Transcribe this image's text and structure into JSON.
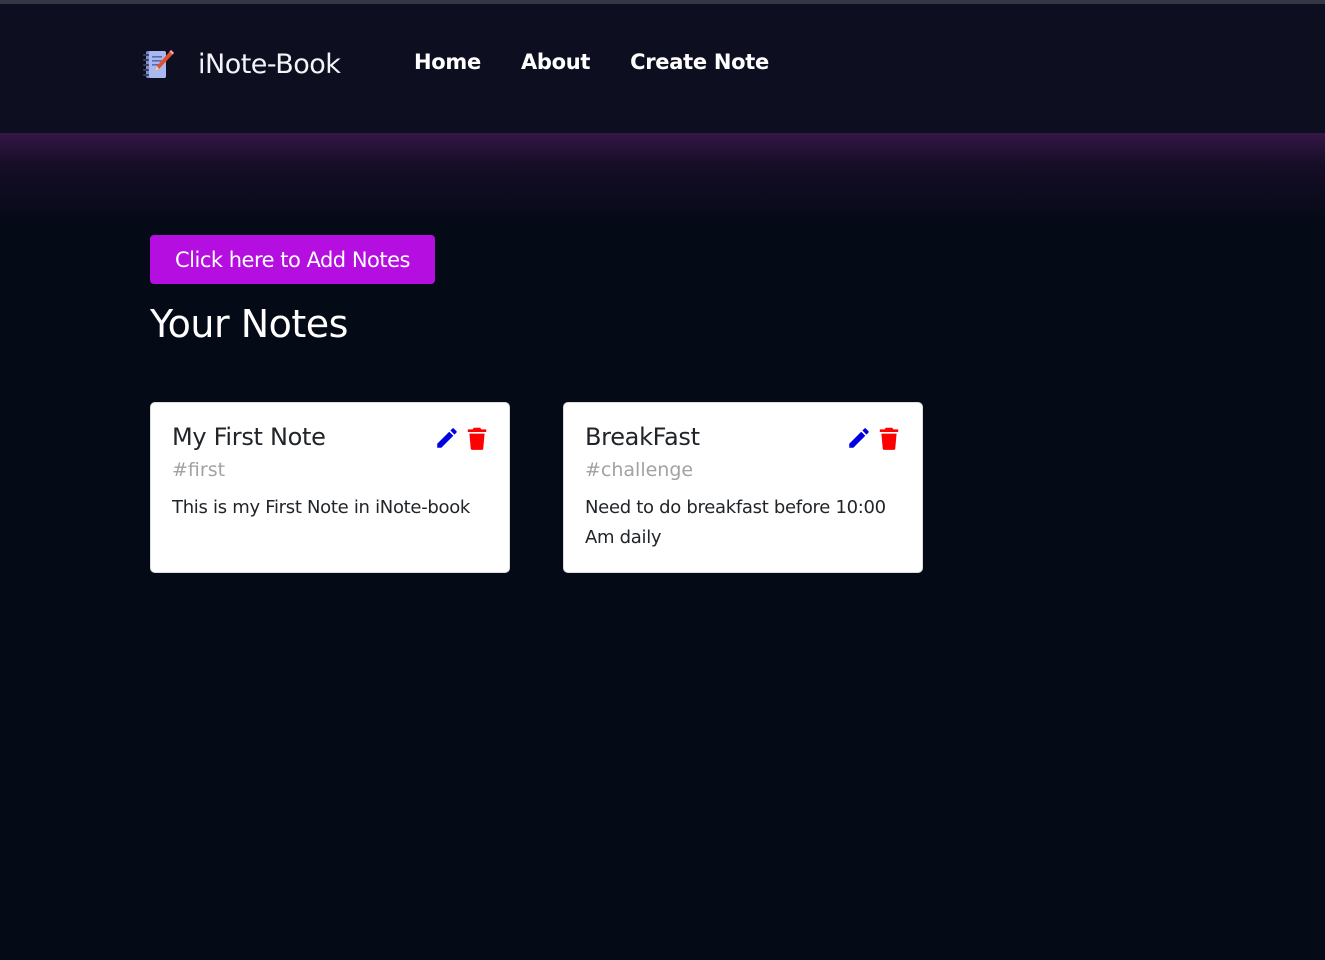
{
  "navbar": {
    "brand_icon": "notebook-pencil-icon",
    "brand": "iNote-Book",
    "links": [
      {
        "label": "Home"
      },
      {
        "label": "About"
      },
      {
        "label": "Create Note"
      }
    ]
  },
  "main": {
    "add_button_label": "Click here to Add Notes",
    "title": "Your Notes",
    "notes": [
      {
        "title": "My First Note",
        "tag": "#first",
        "description": "This is my First Note in iNote-book",
        "edit_icon": "pencil-icon",
        "delete_icon": "trash-icon"
      },
      {
        "title": "BreakFast",
        "tag": "#challenge",
        "description": "Need to do breakfast before 10:00 Am daily",
        "edit_icon": "pencil-icon",
        "delete_icon": "trash-icon"
      }
    ]
  },
  "colors": {
    "background": "#050a17",
    "navbar": "#0d0f21",
    "accent": "#b40ee0",
    "edit": "#0000e0",
    "delete": "#ff0000"
  }
}
